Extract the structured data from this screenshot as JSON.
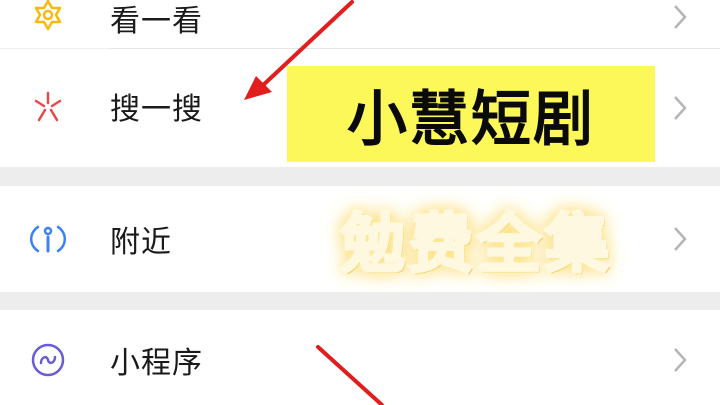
{
  "menu": {
    "items": [
      {
        "label": "看一看",
        "icon": "look-icon"
      },
      {
        "label": "搜一搜",
        "icon": "search-star-icon"
      },
      {
        "label": "附近",
        "icon": "nearby-icon"
      },
      {
        "label": "小程序",
        "icon": "mini-program-icon"
      }
    ]
  },
  "overlay": {
    "title": "小慧短剧",
    "subtitle": "勉费全集"
  },
  "colors": {
    "highlight": "#fcf85a",
    "arrow": "#e11d1d",
    "look_icon": "#f5b90f",
    "search_icon": "#e84a4a",
    "nearby_icon": "#3b82f6",
    "mini_program_icon": "#6b5bd6"
  }
}
